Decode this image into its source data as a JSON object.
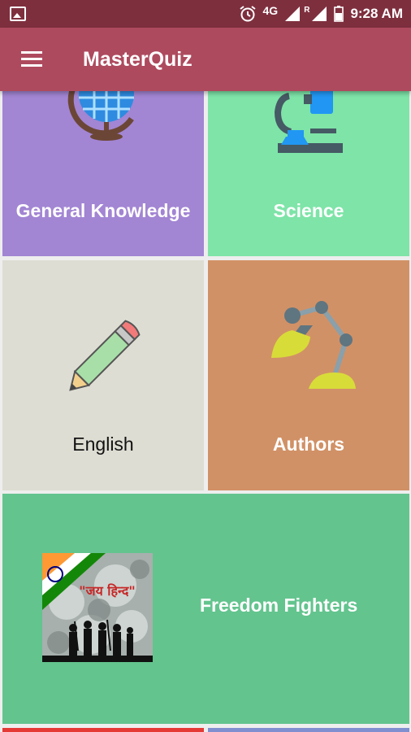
{
  "status_bar": {
    "icons": [
      "gallery-icon",
      "alarm-icon",
      "signal-icon",
      "battery-icon"
    ],
    "network": "4G",
    "roaming": "R",
    "time": "9:28 AM"
  },
  "app_bar": {
    "menu_icon": "hamburger-menu-icon",
    "title": "MasterQuiz"
  },
  "categories": [
    {
      "label": "General Knowledge",
      "icon": "globe-icon",
      "color": "#a285d3"
    },
    {
      "label": "Science",
      "icon": "microscope-icon",
      "color": "#7ee4a8"
    },
    {
      "label": "English",
      "icon": "pencil-icon",
      "color": "#deddd3"
    },
    {
      "label": "Authors",
      "icon": "desk-lamp-icon",
      "color": "#d19166"
    },
    {
      "label": "Freedom Fighters",
      "icon": "freedom-fighters-image",
      "color": "#63c48e",
      "image_text": "\"जय हिन्द\""
    }
  ],
  "colors": {
    "status_bar": "#7e2f3e",
    "app_bar": "#ae4a5e"
  }
}
